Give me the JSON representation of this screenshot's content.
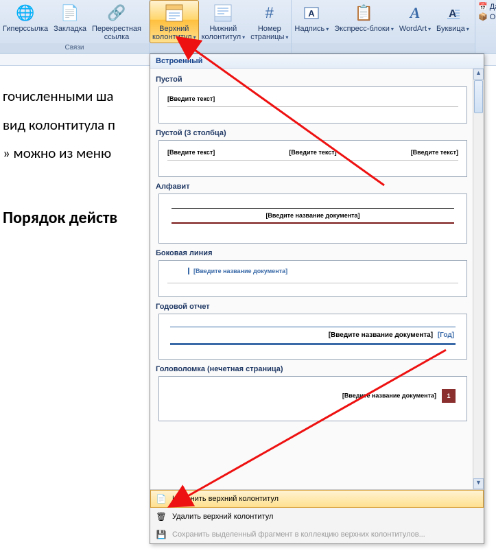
{
  "ribbon": {
    "groups": {
      "links": {
        "label": "Связи",
        "hyperlink": "Гиперссылка",
        "bookmark": "Закладка",
        "crossref": "Перекрестная\nссылка"
      },
      "headerfooter": {
        "header": "Верхний\nколонтитул",
        "footer": "Нижний\nколонтитул",
        "pagenum": "Номер\nстраницы"
      },
      "text": {
        "textbox": "Надпись",
        "quickparts": "Экспресс-блоки",
        "wordart": "WordArt",
        "dropcap": "Буквица"
      },
      "right": {
        "date": "Да",
        "object": "Об"
      }
    }
  },
  "doc": {
    "line1": "гочисленными ша",
    "line2": "вид колонтитула п",
    "line3": "» можно из меню",
    "heading": "Порядок действ"
  },
  "dropdown": {
    "header": "Встроенный",
    "items": {
      "empty": {
        "label": "Пустой",
        "ph": "[Введите текст]"
      },
      "empty3": {
        "label": "Пустой (3 столбца)",
        "ph": "[Введите текст]"
      },
      "alphabet": {
        "label": "Алфавит",
        "ph": "[Введите название документа]"
      },
      "sideline": {
        "label": "Боковая линия",
        "ph": "[Введите название документа]"
      },
      "annual": {
        "label": "Годовой отчет",
        "ph": "[Введите название документа]",
        "year": "[Год]"
      },
      "puzzle": {
        "label": "Головоломка (нечетная страница)",
        "ph": "[Введите название документа]",
        "page": "1"
      }
    },
    "footer": {
      "edit": "Изменить верхний колонтитул",
      "remove": "Удалить верхний колонтитул",
      "save": "Сохранить выделенный фрагмент в коллекцию верхних колонтитулов..."
    }
  }
}
